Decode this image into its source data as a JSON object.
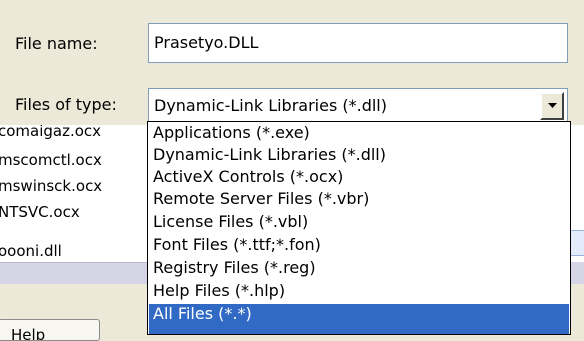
{
  "form": {
    "file_name_label": "File name:",
    "file_name_value": "Prasetyo.DLL",
    "file_type_label": "Files of type:",
    "file_type_value": "Dynamic-Link Libraries (*.dll)"
  },
  "file_list": {
    "items": [
      "comaigaz.ocx",
      "mscomctl.ocx",
      "mswinsck.ocx",
      "NTSVC.ocx",
      "oooni.dll"
    ]
  },
  "buttons": {
    "help_label": "Help"
  },
  "dropdown": {
    "options": [
      "Applications (*.exe)",
      "Dynamic-Link Libraries (*.dll)",
      "ActiveX Controls (*.ocx)",
      "Remote Server Files (*.vbr)",
      "License Files (*.vbl)",
      "Font Files (*.ttf;*.fon)",
      "Registry Files (*.reg)",
      "Help Files (*.hlp)",
      "All Files (*.*)"
    ],
    "selected_index": 8
  },
  "colors": {
    "dialog_bg": "#ece9d8",
    "selection_bg": "#316ac5",
    "field_border": "#7f9db9"
  }
}
